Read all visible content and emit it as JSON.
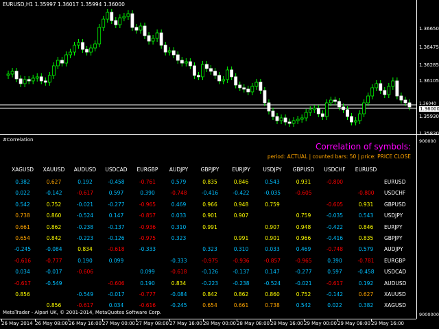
{
  "chart": {
    "title": "EURUSD,H1  1.35997 1.36017 1.35994 1.36000",
    "price_labels": [
      "1.36650",
      "1.36475",
      "1.36285",
      "1.36105",
      "1.35930",
      "1.35830"
    ],
    "current_price": "1.36000",
    "bid_label": "1.36040"
  },
  "indicator": {
    "name": "#Correlation",
    "title": "Correlation of symbols:",
    "subtitle": "period: ACTUAL | counted bars: 50 | price: PRICE CLOSE",
    "axis_top": "900000",
    "axis_bottom": "9000000",
    "copyright": "MetaTrader - Alpari UK, © 2001-2014, MetaQuotes Software Corp.",
    "columns": [
      "XAGUSD",
      "XAUUSD",
      "AUDUSD",
      "USDCAD",
      "EURGBP",
      "AUDJPY",
      "GBPJPY",
      "EURJPY",
      "USDJPY",
      "GBPUSD",
      "USDCHF",
      "EURUSD"
    ],
    "rows": [
      {
        "label": "EURUSD",
        "cells": [
          "0.382",
          "0.627",
          "0.192",
          "-0.458",
          "-0.761",
          "0.579",
          "0.835",
          "0.846",
          "0.543",
          "0.931",
          "-0.800",
          ""
        ]
      },
      {
        "label": "USDCHF",
        "cells": [
          "0.022",
          "-0.142",
          "-0.617",
          "0.597",
          "0.390",
          "-0.748",
          "-0.416",
          "-0.422",
          "-0.035",
          "-0.605",
          "",
          "-0.800"
        ]
      },
      {
        "label": "GBPUSD",
        "cells": [
          "0.542",
          "0.752",
          "-0.021",
          "-0.277",
          "-0.965",
          "0.469",
          "0.966",
          "0.948",
          "0.759",
          "",
          "-0.605",
          "0.931"
        ]
      },
      {
        "label": "USDJPY",
        "cells": [
          "0.738",
          "0.860",
          "-0.524",
          "0.147",
          "-0.857",
          "0.033",
          "0.901",
          "0.907",
          "",
          "0.759",
          "-0.035",
          "0.543"
        ]
      },
      {
        "label": "EURJPY",
        "cells": [
          "0.661",
          "0.862",
          "-0.238",
          "-0.137",
          "-0.936",
          "0.310",
          "0.991",
          "",
          "0.907",
          "0.948",
          "-0.422",
          "0.846"
        ]
      },
      {
        "label": "GBPJPY",
        "cells": [
          "0.654",
          "0.842",
          "-0.223",
          "-0.126",
          "-0.975",
          "0.323",
          "",
          "0.991",
          "0.901",
          "0.966",
          "-0.416",
          "0.835"
        ]
      },
      {
        "label": "AUDJPY",
        "cells": [
          "-0.245",
          "-0.084",
          "0.834",
          "-0.618",
          "-0.333",
          "",
          "0.323",
          "0.310",
          "0.033",
          "0.469",
          "-0.748",
          "0.579"
        ]
      },
      {
        "label": "EURGBP",
        "cells": [
          "-0.616",
          "-0.777",
          "0.190",
          "0.099",
          "",
          "-0.333",
          "-0.975",
          "-0.936",
          "-0.857",
          "-0.965",
          "0.390",
          "-0.781"
        ]
      },
      {
        "label": "USDCAD",
        "cells": [
          "0.034",
          "-0.017",
          "-0.606",
          "",
          "0.099",
          "-0.618",
          "-0.126",
          "-0.137",
          "0.147",
          "-0.277",
          "0.597",
          "-0.458"
        ]
      },
      {
        "label": "AUDUSD",
        "cells": [
          "-0.617",
          "-0.549",
          "",
          "-0.606",
          "0.190",
          "0.834",
          "-0.223",
          "-0.238",
          "-0.524",
          "-0.021",
          "-0.617",
          "0.192"
        ]
      },
      {
        "label": "XAUUSD",
        "cells": [
          "0.856",
          "",
          "-0.549",
          "-0.017",
          "-0.777",
          "-0.084",
          "0.842",
          "0.862",
          "0.860",
          "0.752",
          "-0.142",
          "0.627"
        ]
      },
      {
        "label": "XAGUSD",
        "cells": [
          "",
          "0.856",
          "-0.617",
          "0.034",
          "-0.616",
          "-0.245",
          "0.654",
          "0.661",
          "0.738",
          "0.542",
          "0.022",
          "0.382"
        ]
      }
    ]
  },
  "time_labels": [
    "26 May 2014",
    "26 May 08:00",
    "26 May 16:00",
    "27 May 00:00",
    "27 May 08:00",
    "27 May 16:00",
    "28 May 00:00",
    "28 May 08:00",
    "28 May 16:00",
    "29 May 00:00",
    "29 May 08:00",
    "29 May 16:00"
  ],
  "colors": {
    "bull": "#00ff00",
    "bear": "#ff0000",
    "yellow": "#ffff00",
    "orange": "#ffa500",
    "cyan": "#00bfff",
    "magenta": "#ff00ff"
  }
}
